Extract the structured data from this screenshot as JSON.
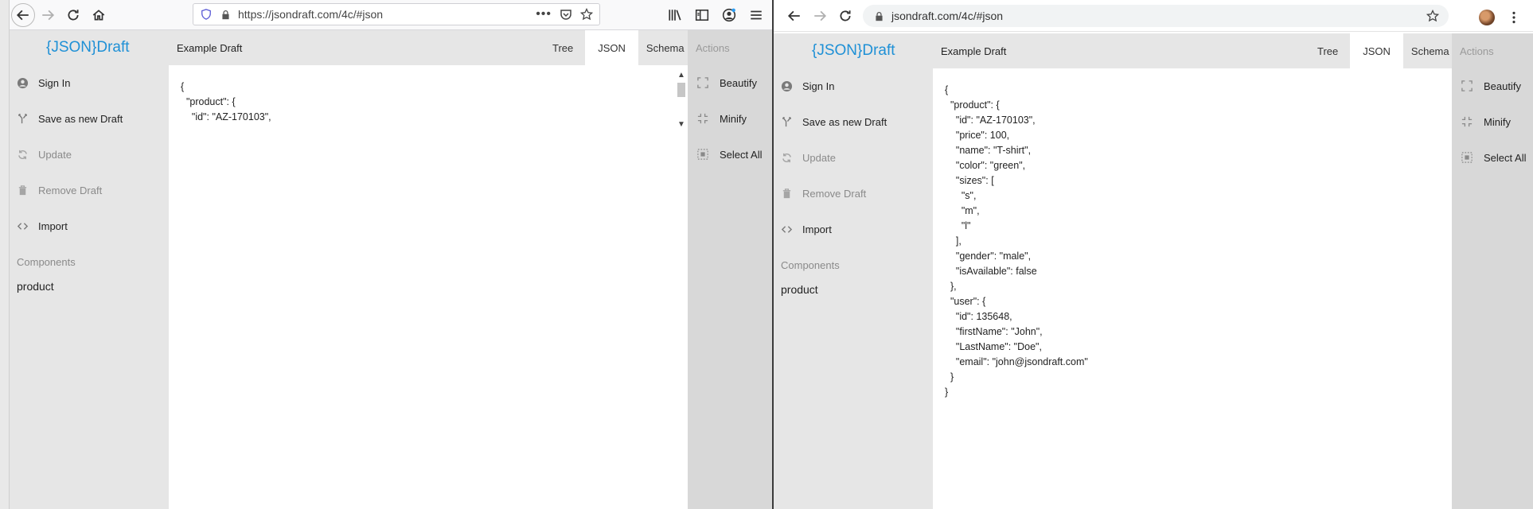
{
  "left_window": {
    "browser": {
      "url": "https://jsondraft.com/4c/#json"
    },
    "app": {
      "logo": "{JSON}Draft",
      "draft_title": "Example Draft",
      "tabs": [
        "Tree",
        "JSON",
        "Schema"
      ],
      "active_tab": "JSON",
      "actions_header": "Actions",
      "menu": [
        "Sign In",
        "Save as new Draft",
        "Update",
        "Remove Draft",
        "Import"
      ],
      "components_header": "Components",
      "components": [
        "product"
      ],
      "actions": [
        "Beautify",
        "Minify",
        "Select All"
      ],
      "code_lines": [
        "{",
        "  \"product\": {",
        "    \"id\": \"AZ-170103\","
      ]
    }
  },
  "right_window": {
    "browser": {
      "url": "jsondraft.com/4c/#json"
    },
    "app": {
      "logo": "{JSON}Draft",
      "draft_title": "Example Draft",
      "tabs": [
        "Tree",
        "JSON",
        "Schema"
      ],
      "active_tab": "JSON",
      "actions_header": "Actions",
      "menu": [
        "Sign In",
        "Save as new Draft",
        "Update",
        "Remove Draft",
        "Import"
      ],
      "components_header": "Components",
      "components": [
        "product"
      ],
      "actions": [
        "Beautify",
        "Minify",
        "Select All"
      ],
      "code_lines": [
        "{",
        "  \"product\": {",
        "    \"id\": \"AZ-170103\",",
        "    \"price\": 100,",
        "    \"name\": \"T-shirt\",",
        "    \"color\": \"green\",",
        "    \"sizes\": [",
        "      \"s\",",
        "      \"m\",",
        "      \"l\"",
        "    ],",
        "    \"gender\": \"male\",",
        "    \"isAvailable\": false",
        "  },",
        "  \"user\": {",
        "    \"id\": 135648,",
        "    \"firstName\": \"John\",",
        "    \"LastName\": \"Doe\",",
        "    \"email\": \"john@jsondraft.com\"",
        "  }",
        "}"
      ]
    }
  },
  "colors": {
    "logo": "#1e90d6",
    "sidebar": "#e6e6e6",
    "actions_panel": "#d8d8d8"
  }
}
